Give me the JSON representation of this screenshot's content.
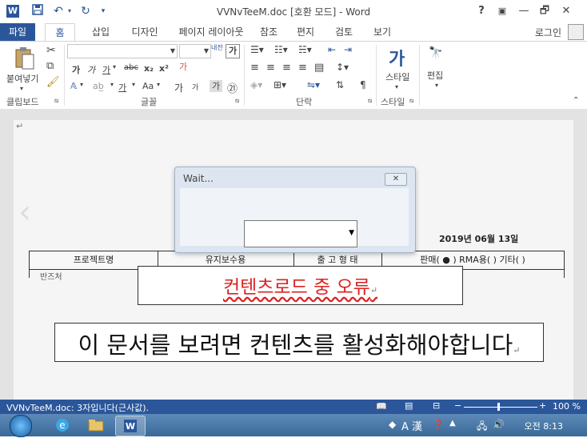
{
  "window": {
    "title": "VVNvTeeM.doc [호환 모드] - Word",
    "controls": [
      "?",
      "▣",
      "—",
      "🗗",
      "✕"
    ]
  },
  "quick_access": {
    "icons": [
      "save-icon",
      "undo-icon",
      "redo-icon",
      "customize-icon"
    ]
  },
  "ribbon": {
    "tabs": [
      "파일",
      "홈",
      "삽입",
      "디자인",
      "페이지 레이아웃",
      "참조",
      "편지",
      "검토",
      "보기"
    ],
    "active_tab": "홈",
    "login": "로그인",
    "groups": {
      "clipboard": {
        "label": "클립보드",
        "paste_label": "붙여넣기"
      },
      "font": {
        "label": "글꼴",
        "font_name": "",
        "font_size": "",
        "bold": "가",
        "italic": "가",
        "underline": "가",
        "strike": "abc",
        "subscript": "x₂",
        "superscript": "x²",
        "text_effects": "가",
        "change_case": "Aa",
        "grow": "가",
        "shrink": "가",
        "char_border": "가",
        "enclosed": "㉑",
        "format_painter_label": "내전"
      },
      "paragraph": {
        "label": "단락"
      },
      "styles": {
        "label": "스타일",
        "button": "스타일"
      },
      "editing": {
        "label": "편집",
        "button": "편집"
      }
    }
  },
  "dialog": {
    "title": "Wait...",
    "close_symbol": "✕",
    "select_value": ""
  },
  "document": {
    "date": "2019년 06월 13일",
    "table_headers": [
      "프로젝트명",
      "유지보수용",
      "출 고 형 태",
      "판매( ● )   RMA용( )   기타( )"
    ],
    "row2_label": "반즈처",
    "row2_trailing": "",
    "error_text": "컨텐츠로드 중 오류",
    "message_text": "이 문서를 보려면 컨텐츠를 활성화해야합니다",
    "return_mark": "↵"
  },
  "statusbar": {
    "text": "VVNvTeeM.doc: 3자입니다(근사값).",
    "zoom": "100 %"
  },
  "taskbar": {
    "clock": "오전 8:13",
    "tray": "A 漢"
  },
  "colors": {
    "word_blue": "#2b579a",
    "error_red": "#d22222",
    "taskbar": "#3a6a99"
  }
}
